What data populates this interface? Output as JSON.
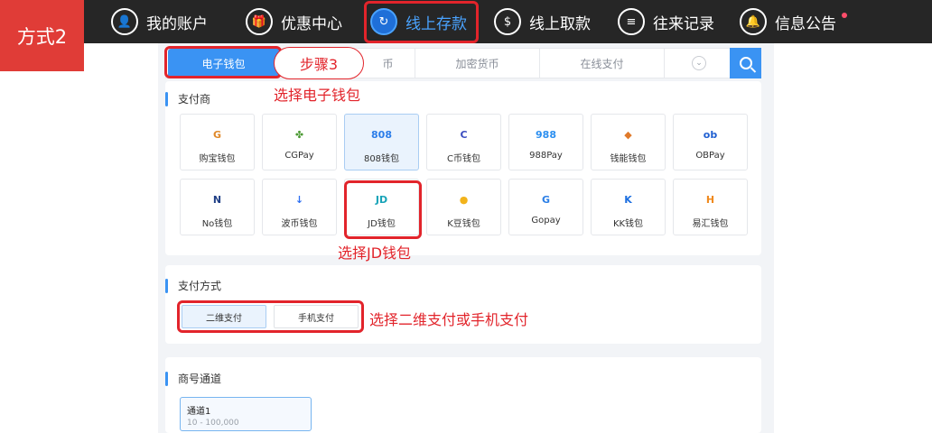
{
  "badge": {
    "label": "方式2"
  },
  "nav": {
    "items": [
      {
        "label": "我的账户",
        "icon": "user-icon",
        "glyph": "👤"
      },
      {
        "label": "优惠中心",
        "icon": "gift-icon",
        "glyph": "🎁"
      },
      {
        "label": "线上存款",
        "icon": "deposit-icon",
        "glyph": "↻"
      },
      {
        "label": "线上取款",
        "icon": "withdraw-icon",
        "glyph": "$"
      },
      {
        "label": "往来记录",
        "icon": "record-icon",
        "glyph": "≡"
      },
      {
        "label": "信息公告",
        "icon": "bell-icon",
        "glyph": "🔔"
      }
    ]
  },
  "tabs": [
    {
      "label": "电子钱包"
    },
    {
      "label": "币"
    },
    {
      "label": "加密货币"
    },
    {
      "label": "在线支付"
    }
  ],
  "step_bubble": "步骤3",
  "annotations": {
    "select_ewallet": "选择电子钱包",
    "select_jd": "选择JD钱包",
    "select_method": "选择二维支付或手机支付"
  },
  "providers": {
    "title": "支付商",
    "items": [
      {
        "name": "购宝钱包",
        "logo": "G",
        "color": "#e0892a",
        "icon": "goubao-logo-icon"
      },
      {
        "name": "CGPay",
        "logo": "✤",
        "color": "#4d9a35",
        "icon": "cgpay-logo-icon"
      },
      {
        "name": "808钱包",
        "logo": "808",
        "color": "#2b7de9",
        "icon": "wallet808-logo-icon"
      },
      {
        "name": "C币钱包",
        "logo": "C",
        "color": "#3b4dbf",
        "icon": "cbi-logo-icon"
      },
      {
        "name": "988Pay",
        "logo": "988",
        "color": "#2c8ff0",
        "icon": "pay988-logo-icon"
      },
      {
        "name": "钱能钱包",
        "logo": "◆",
        "color": "#e07a2a",
        "icon": "qianneng-logo-icon"
      },
      {
        "name": "OBPay",
        "logo": "ob",
        "color": "#1f5fd1",
        "icon": "obpay-logo-icon"
      },
      {
        "name": "No钱包",
        "logo": "N",
        "color": "#1f3f86",
        "icon": "no-wallet-logo-icon"
      },
      {
        "name": "波币钱包",
        "logo": "↓",
        "color": "#2d6ff2",
        "icon": "bobi-logo-icon"
      },
      {
        "name": "JD钱包",
        "logo": "JD",
        "color": "#18a3b8",
        "icon": "jd-logo-icon"
      },
      {
        "name": "K豆钱包",
        "logo": "●",
        "color": "#f2b31b",
        "icon": "kdou-logo-icon"
      },
      {
        "name": "Gopay",
        "logo": "G",
        "color": "#2a7ee6",
        "icon": "gopay-logo-icon"
      },
      {
        "name": "KK钱包",
        "logo": "K",
        "color": "#1d6fe0",
        "icon": "kk-logo-icon"
      },
      {
        "name": "易汇钱包",
        "logo": "H",
        "color": "#f08a1e",
        "icon": "yihui-logo-icon"
      }
    ]
  },
  "payment_method": {
    "title": "支付方式",
    "options": [
      {
        "label": "二维支付"
      },
      {
        "label": "手机支付"
      }
    ]
  },
  "channel": {
    "title": "商号通道",
    "name": "通道1",
    "range": "10 - 100,000"
  }
}
